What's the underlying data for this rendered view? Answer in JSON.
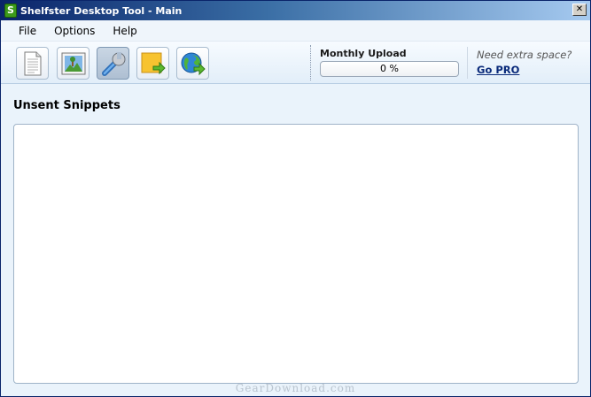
{
  "window": {
    "title": "Shelfster Desktop Tool - Main",
    "app_icon_glyph": "S",
    "close_glyph": "✕"
  },
  "menu": {
    "items": [
      "File",
      "Options",
      "Help"
    ]
  },
  "toolbar": {
    "buttons": [
      {
        "icon": "document-icon"
      },
      {
        "icon": "picture-icon"
      },
      {
        "icon": "wrench-icon"
      },
      {
        "icon": "send-note-icon"
      },
      {
        "icon": "globe-send-icon"
      }
    ],
    "upload": {
      "label": "Monthly Upload",
      "percent_text": "0 %",
      "value": 0
    },
    "extra_space_label": "Need extra space?",
    "go_pro_label": "Go PRO"
  },
  "main": {
    "section_title": "Unsent Snippets"
  },
  "watermark": "GearDownload.com",
  "colors": {
    "title_bar_start": "#0a246a",
    "title_bar_end": "#a6caf0",
    "link": "#0a2a7a",
    "panel_border": "#9fb3c8"
  }
}
